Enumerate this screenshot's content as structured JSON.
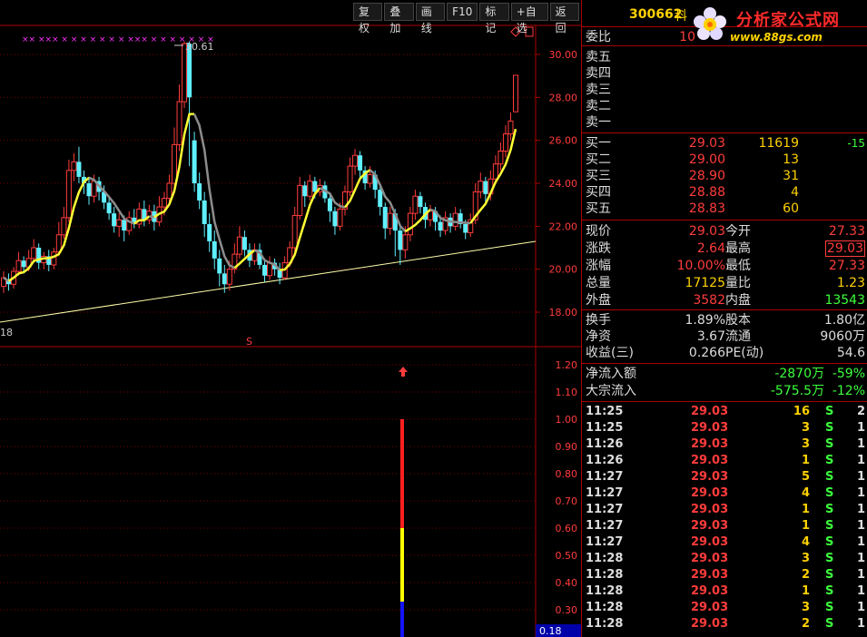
{
  "toolbar": {
    "buttons": [
      "复权",
      "叠加",
      "画线",
      "F10",
      "标记",
      "+自选",
      "返回"
    ]
  },
  "chart": {
    "price_axis": [
      "30.00",
      "28.00",
      "26.00",
      "24.00",
      "22.00",
      "20.00",
      "18.00"
    ],
    "indicator_axis": [
      "1.20",
      "1.10",
      "1.00",
      "0.90",
      "0.80",
      "0.70",
      "0.60",
      "0.50",
      "0.40",
      "0.30"
    ],
    "high_label": "30.61",
    "low_label": "18",
    "indicator_value": "0.18",
    "marker_s": "S",
    "top_markers": "×× ××× × × × × × × × ××× × × × × × × ×"
  },
  "quote": {
    "code": "300662",
    "name_partial": "科",
    "weibi_label": "委比",
    "weibi_value": "10",
    "sell": [
      {
        "label": "卖五",
        "price": "",
        "vol": ""
      },
      {
        "label": "卖四",
        "price": "",
        "vol": ""
      },
      {
        "label": "卖三",
        "price": "",
        "vol": ""
      },
      {
        "label": "卖二",
        "price": "",
        "vol": ""
      },
      {
        "label": "卖一",
        "price": "",
        "vol": ""
      }
    ],
    "buy": [
      {
        "label": "买一",
        "price": "29.03",
        "vol": "11619",
        "chg": "-15"
      },
      {
        "label": "买二",
        "price": "29.00",
        "vol": "13",
        "chg": ""
      },
      {
        "label": "买三",
        "price": "28.90",
        "vol": "31",
        "chg": ""
      },
      {
        "label": "买四",
        "price": "28.88",
        "vol": "4",
        "chg": ""
      },
      {
        "label": "买五",
        "price": "28.83",
        "vol": "60",
        "chg": ""
      }
    ],
    "stats": [
      {
        "l1": "现价",
        "v1": "29.03",
        "l2": "今开",
        "v2": "27.33"
      },
      {
        "l1": "涨跌",
        "v1": "2.64",
        "l2": "最高",
        "v2": "29.03"
      },
      {
        "l1": "涨幅",
        "v1": "10.00%",
        "l2": "最低",
        "v2": "27.33"
      },
      {
        "l1": "总量",
        "v1": "17125",
        "l2": "量比",
        "v2": "1.23"
      },
      {
        "l1": "外盘",
        "v1": "3582",
        "l2": "内盘",
        "v2": "13543"
      }
    ],
    "info": [
      {
        "l1": "换手",
        "v1": "1.89%",
        "l2": "股本",
        "v2": "1.80亿"
      },
      {
        "l1": "净资",
        "v1": "3.67",
        "l2": "流通",
        "v2": "9060万"
      },
      {
        "l1": "收益(三)",
        "v1": "0.266",
        "l2": "PE(动)",
        "v2": "54.6"
      }
    ],
    "flow": [
      {
        "label": "净流入额",
        "value": "-2870万",
        "pct": "-59%"
      },
      {
        "label": "大宗流入",
        "value": "-575.5万",
        "pct": "-12%"
      }
    ],
    "ticks": [
      {
        "time": "11:25",
        "price": "29.03",
        "vol": "16",
        "side": "S",
        "n": "2"
      },
      {
        "time": "11:25",
        "price": "29.03",
        "vol": "3",
        "side": "S",
        "n": "1"
      },
      {
        "time": "11:26",
        "price": "29.03",
        "vol": "3",
        "side": "S",
        "n": "1"
      },
      {
        "time": "11:26",
        "price": "29.03",
        "vol": "1",
        "side": "S",
        "n": "1"
      },
      {
        "time": "11:27",
        "price": "29.03",
        "vol": "5",
        "side": "S",
        "n": "1"
      },
      {
        "time": "11:27",
        "price": "29.03",
        "vol": "4",
        "side": "S",
        "n": "1"
      },
      {
        "time": "11:27",
        "price": "29.03",
        "vol": "1",
        "side": "S",
        "n": "1"
      },
      {
        "time": "11:27",
        "price": "29.03",
        "vol": "1",
        "side": "S",
        "n": "1"
      },
      {
        "time": "11:27",
        "price": "29.03",
        "vol": "4",
        "side": "S",
        "n": "1"
      },
      {
        "time": "11:28",
        "price": "29.03",
        "vol": "3",
        "side": "S",
        "n": "1"
      },
      {
        "time": "11:28",
        "price": "29.03",
        "vol": "2",
        "side": "S",
        "n": "1"
      },
      {
        "time": "11:28",
        "price": "29.03",
        "vol": "1",
        "side": "S",
        "n": "1"
      },
      {
        "time": "11:28",
        "price": "29.03",
        "vol": "3",
        "side": "S",
        "n": "1"
      },
      {
        "time": "11:28",
        "price": "29.03",
        "vol": "2",
        "side": "S",
        "n": "1"
      }
    ]
  },
  "logo": {
    "title": "分析家公式网",
    "url": "www.88gs.com"
  },
  "colors": {
    "up": "#ff3c3c",
    "down": "#5ff0ff",
    "ma_yellow": "#ffff33",
    "ma_gray": "#8c8c8c",
    "grid": "#7a0000"
  }
}
